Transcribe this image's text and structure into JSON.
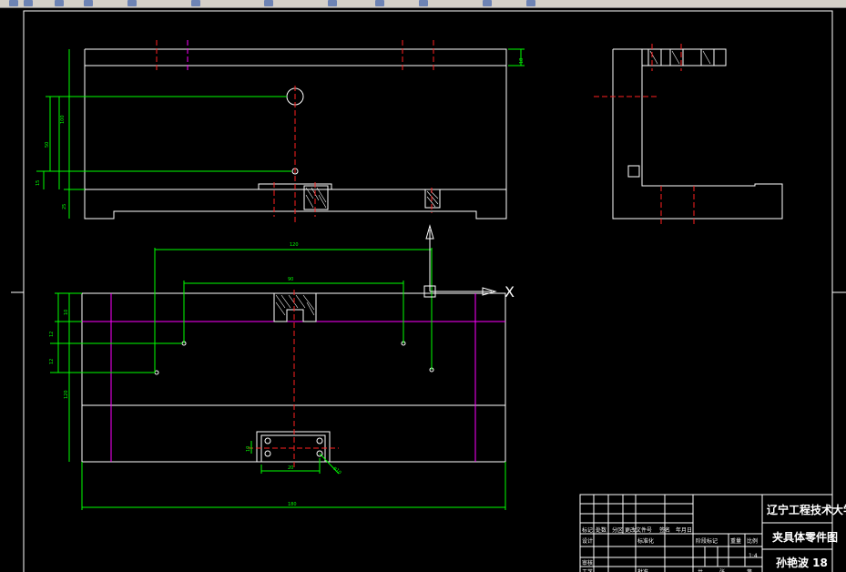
{
  "toolbar": {
    "icons": [
      "undo-icon",
      "redo-icon",
      "pan-icon",
      "zoom-icon",
      "layer-icon",
      "properties-icon",
      "match-icon",
      "calculator-icon",
      "grid-icon",
      "snap-icon",
      "ortho-icon",
      "block-icon"
    ]
  },
  "dimensions": {
    "top_view": [
      "100",
      "50",
      "15",
      "25",
      "18"
    ],
    "plan_view": {
      "overall_width": "180",
      "inner_span": "120",
      "upper_span": "90",
      "left_a": "10",
      "left_b": "12",
      "left_c": "12",
      "left_height": "120",
      "pad_a": "10",
      "pad_width": "20",
      "pad_hole": "φ10"
    }
  },
  "title_block": {
    "school": "辽宁工程技术大学",
    "drawing_name": "夹具体零件图",
    "author": "孙艳波 18",
    "scale": "1:4",
    "row_labels": [
      "标记",
      "处数",
      "分区",
      "更改文件号",
      "签名",
      "年月日"
    ],
    "small_labels": [
      "设计",
      "审核",
      "工艺",
      "批准",
      "标准化",
      "阶段标记",
      "重量",
      "比例",
      "共",
      "张",
      "第"
    ]
  },
  "colors": {
    "background": "#000000",
    "outline": "#ffffff",
    "center_line": "#ff2020",
    "dimension": "#00ff00",
    "hidden": "#ff00ff"
  }
}
